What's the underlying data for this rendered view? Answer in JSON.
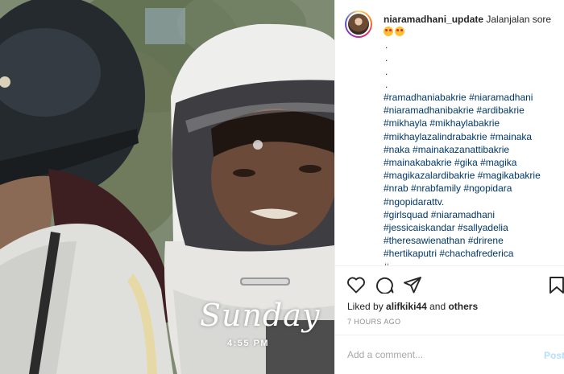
{
  "post": {
    "username": "niaramadhani_update",
    "caption": "Jalanjalan sore",
    "emoji_icons": [
      "heart-eyes-emoji-icon",
      "smiling-hearts-emoji-icon"
    ],
    "dots": [
      ".",
      ".",
      ".",
      "."
    ],
    "hashtag_lines": [
      "#ramadhaniabakrie #niaramadhani",
      "#niaramadhanibakrie #ardibakrie",
      "#mikhayla #mikhaylabakrie",
      "#mikhaylazalindrabakrie #mainaka",
      "#naka #mainakazanattibakrie",
      "#mainakabakrie #gika #magika",
      "#magikazalardibakrie #magikabakrie",
      "#nrab #nrabfamily #ngopidara",
      "#ngopidarattv.",
      "#girlsquad #niaramadhani",
      "#jessicaiskandar #sallyadelia",
      "#theresawienathan #drirene",
      "#hertikaputri #chachafrederica",
      "#..."
    ],
    "liked_by_prefix": "Liked by",
    "liked_by_user": "alifkiki44",
    "liked_by_and": "and",
    "liked_by_others": "others",
    "time_ago": "7 HOURS AGO"
  },
  "media": {
    "overlay_day": "Sunday",
    "overlay_time": "4:55 PM"
  },
  "actions": {
    "icons": [
      "heart-icon",
      "comment-icon",
      "share-icon",
      "bookmark-icon"
    ]
  },
  "comment": {
    "placeholder": "Add a comment...",
    "post_label": "Post"
  },
  "colors": {
    "text": "#262626",
    "link": "#00376b",
    "muted": "#8e8e8e",
    "post_button": "#b2dffc",
    "border": "#efefef"
  }
}
